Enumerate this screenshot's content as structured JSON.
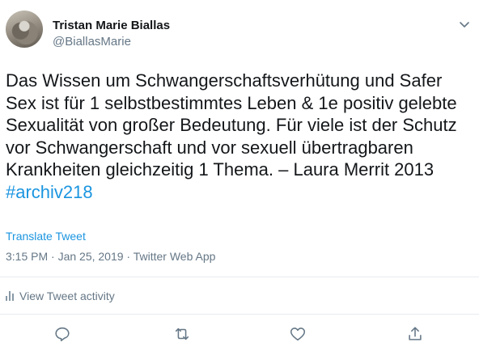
{
  "tweet": {
    "author_name": "Tristan Marie Biallas",
    "author_handle": "@BiallasMarie",
    "body_text": "Das Wissen um Schwangerschaftsverhütung und Safer\nSex ist für 1 selbstbestimmtes Leben & 1e positiv gelebte\nSexualität von großer Bedeutung. Für viele ist der Schutz\nvor Schwangerschaft und vor sexuell übertragbaren\nKrankheiten gleichzeitig 1 Thema. – Laura Merrit 2013",
    "hashtag": "#archiv218",
    "translate_label": "Translate Tweet",
    "meta": "3:15 PM · Jan 25, 2019 · Twitter Web App",
    "activity_label": "View Tweet activity"
  },
  "icons": {
    "avatar": "avatar-photo",
    "more": "chevron-down-icon",
    "activity": "bar-chart-icon",
    "reply": "reply-icon",
    "retweet": "retweet-icon",
    "like": "heart-icon",
    "share": "share-icon"
  },
  "colors": {
    "link": "#1b95e0",
    "secondary_text": "#657786",
    "primary_text": "#14171a",
    "divider": "#e6ecf0",
    "icon": "#657786"
  }
}
